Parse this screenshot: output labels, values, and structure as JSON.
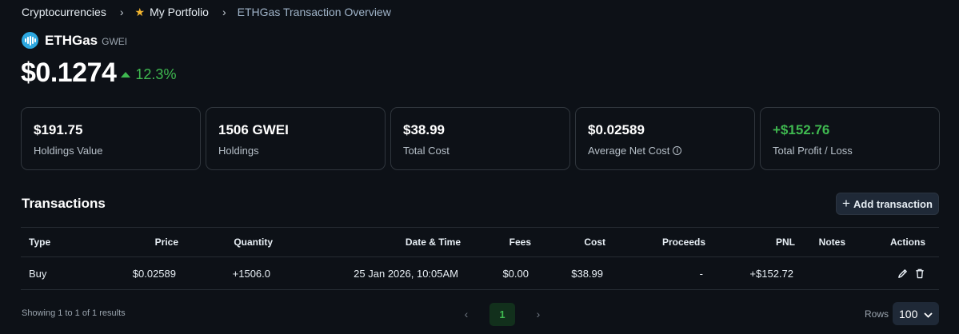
{
  "breadcrumb": {
    "items": [
      "Cryptocurrencies",
      "My Portfolio",
      "ETHGas Transaction Overview"
    ]
  },
  "coin": {
    "name": "ETHGas",
    "unit": "GWEI",
    "logo_color": "#2da8e0"
  },
  "price": {
    "value": "$0.1274",
    "change": "12.3%",
    "direction": "up"
  },
  "cards": [
    {
      "value": "$191.75",
      "label": "Holdings Value"
    },
    {
      "value": "1506 GWEI",
      "label": "Holdings"
    },
    {
      "value": "$38.99",
      "label": "Total Cost"
    },
    {
      "value": "$0.02589",
      "label": "Average Net Cost"
    },
    {
      "value": "+$152.76",
      "label": "Total Profit / Loss"
    }
  ],
  "transactions": {
    "title": "Transactions",
    "add_label": "Add transaction",
    "columns": [
      "Type",
      "Price",
      "Quantity",
      "Date & Time",
      "Fees",
      "Cost",
      "Proceeds",
      "PNL",
      "Notes",
      "Actions"
    ],
    "rows": [
      {
        "type": "Buy",
        "price": "$0.02589",
        "quantity": "+1506.0",
        "datetime": "25 Jan 2026, 10:05AM",
        "fees": "$0.00",
        "cost": "$38.99",
        "proceeds": "-",
        "pnl": "+$152.72",
        "notes": ""
      }
    ]
  },
  "footer": {
    "results": "Showing 1 to 1 of 1 results",
    "page": "1",
    "rows_label": "Rows",
    "rows_value": "100"
  },
  "colors": {
    "background": "#0d1117",
    "positive": "#3fb950",
    "star": "#f5b730"
  }
}
